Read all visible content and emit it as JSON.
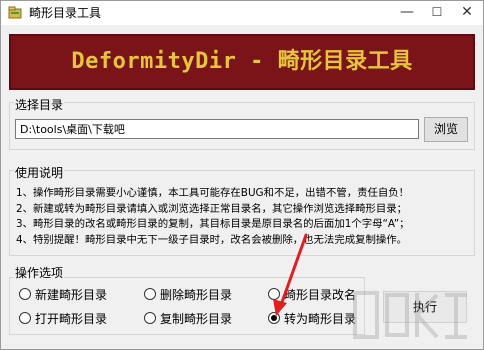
{
  "window": {
    "title": "畸形目录工具",
    "minimize_label": "—",
    "maximize_label": "☐",
    "close_label": "✕"
  },
  "banner": {
    "text": "DeformityDir - 畸形目录工具",
    "bg_color": "#7a1418",
    "text_color": "#e6c43c"
  },
  "dir_group": {
    "label": "选择目录",
    "path_value": "D:\\tools\\桌面\\下载吧",
    "browse_label": "浏览"
  },
  "help_group": {
    "label": "使用说明",
    "lines": [
      "1、操作畸形目录需要小心谨慎，本工具可能存在BUG和不足，出错不管，责任自负！",
      "2、新建或转为畸形目录请填入或浏览选择正常目录名，其它操作浏览选择畸形目录；",
      "3、畸形目录的改名或畸形目录的复制，其目标目录是原目录名的后面加1个字母“A”；",
      "4、特别提醒！畸形目录中无下一级子目录时，改名会被删除，也无法完成复制操作。"
    ]
  },
  "ops_group": {
    "label": "操作选项",
    "options": [
      {
        "label": "新建畸形目录",
        "checked": false
      },
      {
        "label": "删除畸形目录",
        "checked": false
      },
      {
        "label": "畸形目录改名",
        "checked": false
      },
      {
        "label": "打开畸形目录",
        "checked": false
      },
      {
        "label": "复制畸形目录",
        "checked": false
      },
      {
        "label": "转为畸形目录",
        "checked": true
      }
    ],
    "execute_label": "执行"
  },
  "annotation": {
    "arrow_color": "#e02020"
  }
}
